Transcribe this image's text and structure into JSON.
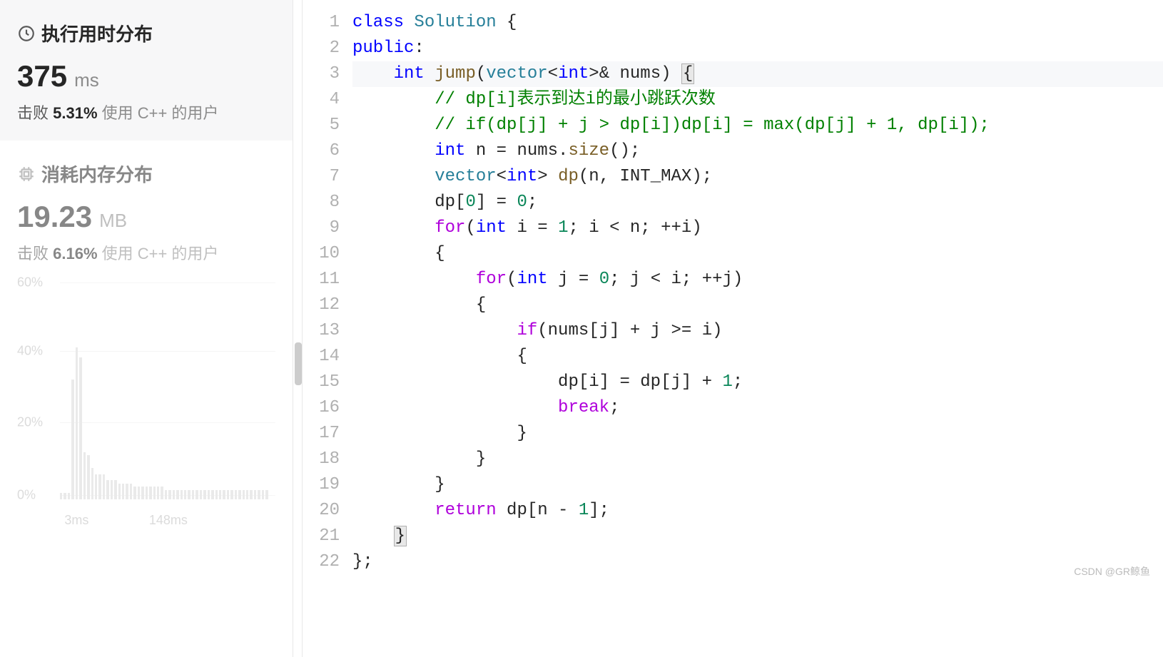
{
  "sidebar": {
    "runtime": {
      "icon": "clock-icon",
      "title": "执行用时分布",
      "value": "375",
      "unit": "ms",
      "beat_prefix": "击败 ",
      "beat_pct": "5.31%",
      "beat_rest": " 使用 C++ 的用户"
    },
    "memory": {
      "icon": "chip-icon",
      "title": "消耗内存分布",
      "value": "19.23",
      "unit": "MB",
      "beat_prefix": "击败 ",
      "beat_pct": "6.16%",
      "beat_rest": " 使用 C++ 的用户"
    }
  },
  "chart_data": {
    "type": "bar",
    "ylabels": [
      "60%",
      "40%",
      "20%",
      "0%"
    ],
    "ylim": [
      0,
      70
    ],
    "xlabels": [
      {
        "text": "3ms",
        "pos_pct": 8
      },
      {
        "text": "148ms",
        "pos_pct": 52
      }
    ],
    "gridlines_pct": [
      2,
      33,
      65,
      98
    ],
    "bars_pct": [
      2,
      2,
      2,
      38,
      48,
      45,
      15,
      14,
      10,
      8,
      8,
      8,
      6,
      6,
      6,
      5,
      5,
      5,
      5,
      4,
      4,
      4,
      4,
      4,
      4,
      4,
      4,
      3,
      3,
      3,
      3,
      3,
      3,
      3,
      3,
      3,
      3,
      3,
      3,
      3,
      3,
      3,
      3,
      3,
      3,
      3,
      3,
      3,
      3,
      3,
      3,
      3,
      3,
      3
    ]
  },
  "code": {
    "lines": [
      {
        "n": 1,
        "tokens": [
          [
            "kw",
            "class"
          ],
          [
            "",
            " "
          ],
          [
            "type",
            "Solution"
          ],
          [
            "",
            " {"
          ]
        ]
      },
      {
        "n": 2,
        "tokens": [
          [
            "kw",
            "public"
          ],
          [
            "",
            ":"
          ]
        ]
      },
      {
        "n": 3,
        "hl": true,
        "tokens": [
          [
            "",
            "    "
          ],
          [
            "kw",
            "int"
          ],
          [
            "",
            " "
          ],
          [
            "fn",
            "jump"
          ],
          [
            "",
            "("
          ],
          [
            "type",
            "vector"
          ],
          [
            "",
            "<"
          ],
          [
            "kw",
            "int"
          ],
          [
            "",
            ">& nums) "
          ],
          [
            "brace",
            "{"
          ]
        ]
      },
      {
        "n": 4,
        "tokens": [
          [
            "",
            "        "
          ],
          [
            "cm",
            "// dp[i]表示到达i的最小跳跃次数"
          ]
        ]
      },
      {
        "n": 5,
        "tokens": [
          [
            "",
            "        "
          ],
          [
            "cm",
            "// if(dp[j] + j > dp[i])dp[i] = max(dp[j] + 1, dp[i]);"
          ]
        ]
      },
      {
        "n": 6,
        "tokens": [
          [
            "",
            "        "
          ],
          [
            "kw",
            "int"
          ],
          [
            "",
            " n = nums."
          ],
          [
            "fn",
            "size"
          ],
          [
            "",
            "();"
          ]
        ]
      },
      {
        "n": 7,
        "tokens": [
          [
            "",
            "        "
          ],
          [
            "type",
            "vector"
          ],
          [
            "",
            "<"
          ],
          [
            "kw",
            "int"
          ],
          [
            "",
            "> "
          ],
          [
            "fn",
            "dp"
          ],
          [
            "",
            "(n, INT_MAX);"
          ]
        ]
      },
      {
        "n": 8,
        "tokens": [
          [
            "",
            "        dp["
          ],
          [
            "num",
            "0"
          ],
          [
            "",
            "] = "
          ],
          [
            "num",
            "0"
          ],
          [
            "",
            ";"
          ]
        ]
      },
      {
        "n": 9,
        "tokens": [
          [
            "",
            "        "
          ],
          [
            "ctrl",
            "for"
          ],
          [
            "",
            "("
          ],
          [
            "kw",
            "int"
          ],
          [
            "",
            " i = "
          ],
          [
            "num",
            "1"
          ],
          [
            "",
            "; i < n; ++i)"
          ]
        ]
      },
      {
        "n": 10,
        "tokens": [
          [
            "",
            "        {"
          ]
        ]
      },
      {
        "n": 11,
        "tokens": [
          [
            "",
            "            "
          ],
          [
            "ctrl",
            "for"
          ],
          [
            "",
            "("
          ],
          [
            "kw",
            "int"
          ],
          [
            "",
            " j = "
          ],
          [
            "num",
            "0"
          ],
          [
            "",
            "; j < i; ++j)"
          ]
        ]
      },
      {
        "n": 12,
        "tokens": [
          [
            "",
            "            {"
          ]
        ]
      },
      {
        "n": 13,
        "tokens": [
          [
            "",
            "                "
          ],
          [
            "ctrl",
            "if"
          ],
          [
            "",
            "(nums[j] + j >= i)"
          ]
        ]
      },
      {
        "n": 14,
        "tokens": [
          [
            "",
            "                {"
          ]
        ]
      },
      {
        "n": 15,
        "tokens": [
          [
            "",
            "                    dp[i] = dp[j] + "
          ],
          [
            "num",
            "1"
          ],
          [
            "",
            ";"
          ]
        ]
      },
      {
        "n": 16,
        "tokens": [
          [
            "",
            "                    "
          ],
          [
            "ctrl",
            "break"
          ],
          [
            "",
            ";"
          ]
        ]
      },
      {
        "n": 17,
        "tokens": [
          [
            "",
            "                }"
          ]
        ]
      },
      {
        "n": 18,
        "tokens": [
          [
            "",
            "            }"
          ]
        ]
      },
      {
        "n": 19,
        "tokens": [
          [
            "",
            "        }"
          ]
        ]
      },
      {
        "n": 20,
        "tokens": [
          [
            "",
            "        "
          ],
          [
            "ctrl",
            "return"
          ],
          [
            "",
            " dp[n - "
          ],
          [
            "num",
            "1"
          ],
          [
            "",
            "];"
          ]
        ]
      },
      {
        "n": 21,
        "tokens": [
          [
            "",
            "    "
          ],
          [
            "brace",
            "}"
          ]
        ]
      },
      {
        "n": 22,
        "tokens": [
          [
            "",
            "};"
          ]
        ]
      }
    ]
  },
  "watermark": "CSDN @GR鲸鱼"
}
